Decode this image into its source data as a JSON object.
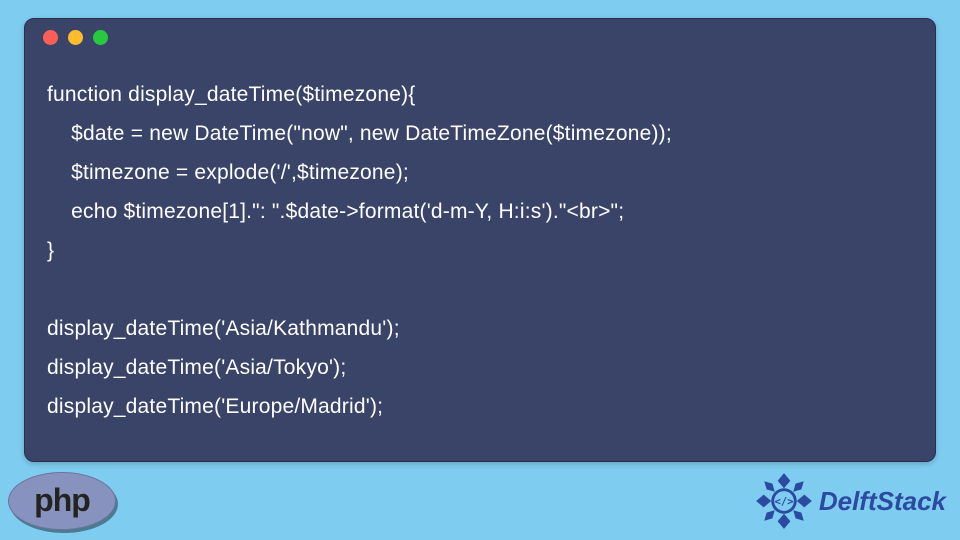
{
  "code": {
    "lines": [
      "function display_dateTime($timezone){",
      "    $date = new DateTime(\"now\", new DateTimeZone($timezone));",
      "    $timezone = explode('/',$timezone);",
      "    echo $timezone[1].\": \".$date->format('d-m-Y, H:i:s').\"<br>\";",
      "}",
      "",
      "display_dateTime('Asia/Kathmandu');",
      "display_dateTime('Asia/Tokyo');",
      "display_dateTime('Europe/Madrid');"
    ]
  },
  "footer": {
    "php_label": "php",
    "brand_label": "DelftStack"
  }
}
